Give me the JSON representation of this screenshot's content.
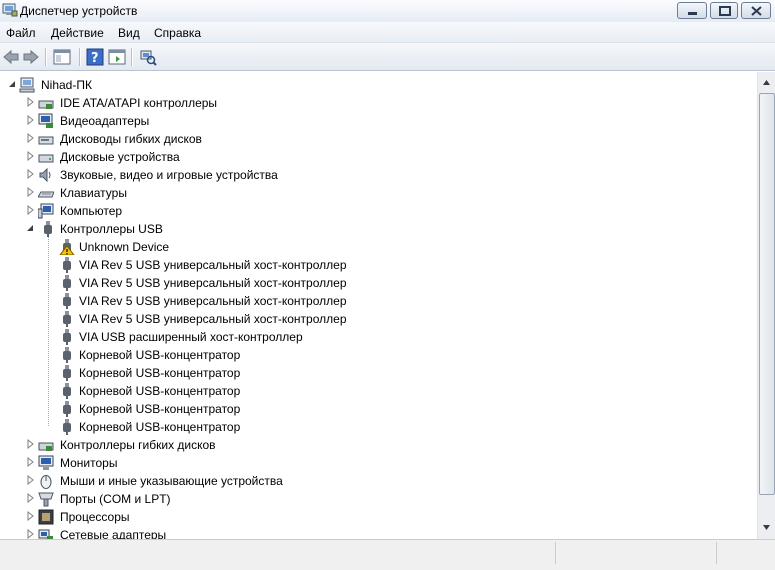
{
  "window": {
    "title": "Диспетчер устройств"
  },
  "menu": {
    "items": [
      "Файл",
      "Действие",
      "Вид",
      "Справка"
    ]
  },
  "toolbar": {
    "buttons": [
      "back-icon",
      "forward-icon",
      "console-tree-icon",
      "help-icon",
      "properties-icon",
      "scan-hardware-icon"
    ]
  },
  "tree": {
    "root": "Nihad-ПК",
    "categories_top": [
      {
        "label": "IDE ATA/ATAPI контроллеры",
        "icon": "ide-controller-icon"
      },
      {
        "label": "Видеоадаптеры",
        "icon": "display-adapter-icon"
      },
      {
        "label": "Дисководы гибких дисков",
        "icon": "floppy-drive-icon"
      },
      {
        "label": "Дисковые устройства",
        "icon": "disk-drive-icon"
      },
      {
        "label": "Звуковые, видео и игровые устройства",
        "icon": "sound-icon"
      },
      {
        "label": "Клавиатуры",
        "icon": "keyboard-icon"
      },
      {
        "label": "Компьютер",
        "icon": "computer-icon"
      },
      {
        "label": "Контроллеры USB",
        "icon": "usb-icon"
      }
    ],
    "usb_children": [
      {
        "label": "Unknown Device",
        "icon": "warning-usb-icon"
      },
      {
        "label": "VIA Rev 5 USB универсальный хост-контроллер",
        "icon": "usb-icon"
      },
      {
        "label": "VIA Rev 5 USB универсальный хост-контроллер",
        "icon": "usb-icon"
      },
      {
        "label": "VIA Rev 5 USB универсальный хост-контроллер",
        "icon": "usb-icon"
      },
      {
        "label": "VIA Rev 5 USB универсальный хост-контроллер",
        "icon": "usb-icon"
      },
      {
        "label": "VIA USB расширенный хост-контроллер",
        "icon": "usb-icon"
      },
      {
        "label": "Корневой USB-концентратор",
        "icon": "usb-icon"
      },
      {
        "label": "Корневой USB-концентратор",
        "icon": "usb-icon"
      },
      {
        "label": "Корневой USB-концентратор",
        "icon": "usb-icon"
      },
      {
        "label": "Корневой USB-концентратор",
        "icon": "usb-icon"
      },
      {
        "label": "Корневой USB-концентратор",
        "icon": "usb-icon"
      }
    ],
    "categories_bottom": [
      {
        "label": "Контроллеры гибких дисков",
        "icon": "floppy-controller-icon"
      },
      {
        "label": "Мониторы",
        "icon": "monitor-icon"
      },
      {
        "label": "Мыши и иные указывающие устройства",
        "icon": "mouse-icon"
      },
      {
        "label": "Порты (COM и LPT)",
        "icon": "port-icon"
      },
      {
        "label": "Процессоры",
        "icon": "processor-icon"
      },
      {
        "label": "Сетевые адаптеры",
        "icon": "network-adapter-icon"
      }
    ]
  },
  "colors": {
    "warning": "#f5c400",
    "selection_line": "#c0c0c0"
  }
}
